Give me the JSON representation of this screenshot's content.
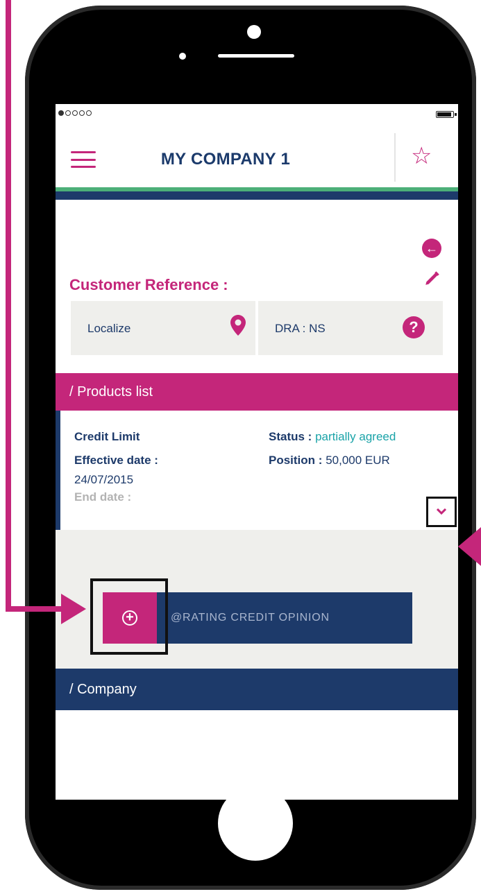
{
  "status_bar": {
    "signal": "●○○○○",
    "battery_icon": "battery-full-icon"
  },
  "navbar": {
    "menu_icon": "hamburger-menu-icon",
    "title": "MY COMPANY 1",
    "favorite_icon": "star-outline-icon"
  },
  "customer": {
    "back_icon": "arrow-left-circle-icon",
    "reference_label": "Customer Reference :",
    "edit_icon": "pencil-icon",
    "localize_label": "Localize",
    "localize_icon": "map-pin-icon",
    "dra_label": "DRA : NS",
    "help_icon": "question-circle-icon"
  },
  "products": {
    "header": "/ Products list",
    "item": {
      "name": "Credit Limit",
      "status_label": "Status :",
      "status_value": "partially agreed",
      "effective_label": "Effective date :",
      "effective_value": "24/07/2015",
      "position_label": "Position :",
      "position_value": "50,000 EUR",
      "end_label": "End date :"
    },
    "expand_icon": "chevron-down-icon"
  },
  "rating_button": {
    "icon": "plus-circle-icon",
    "label": "@RATING CREDIT OPINION"
  },
  "company": {
    "header": "/ Company"
  },
  "colors": {
    "brand_pink": "#c4267a",
    "navy": "#1d3a6a",
    "green_accent": "#4caf78",
    "teal_status": "#1aa3a8"
  }
}
